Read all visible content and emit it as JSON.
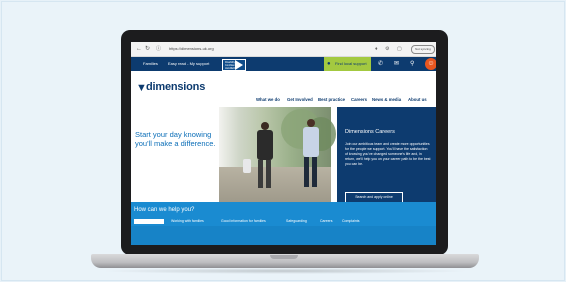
{
  "browser": {
    "url": "https://dimensions-uk.org",
    "profile_button": "Not syncing",
    "icons": [
      "back-icon",
      "reload-icon",
      "info-icon",
      "translate-icon",
      "extension-icon",
      "tab-icon"
    ]
  },
  "top_nav": {
    "links": [
      "Families",
      "Easy read - My support"
    ],
    "logo_text": "Disability Confident LEADER",
    "find_local": "Find local support",
    "icons": [
      "phone-icon",
      "mail-icon",
      "search-icon",
      "accessibility-icon"
    ]
  },
  "header": {
    "logo": "dimensions",
    "nav": [
      "What we do",
      "Get Involved",
      "Best practice",
      "Careers",
      "News & media",
      "About us"
    ]
  },
  "hero": {
    "heading": "Start your day knowing you'll make a difference."
  },
  "careers": {
    "title": "Dimensions Careers",
    "body": "Join our ambitious team and create more opportunities for the people we support. You'll have the satisfaction of knowing you've changed someone's life and, in return, we'll help you on your career path to be the best you can be.",
    "button": "Search and apply online"
  },
  "help": {
    "title": "How can we help you?",
    "tabs": [
      "",
      "Working with families",
      "Good information for families",
      "Safeguarding",
      "Careers",
      "Complaints"
    ]
  },
  "colors": {
    "navy": "#0d3b6f",
    "blue": "#1a8bd1",
    "green": "#a3c940",
    "accessibility": "#e9561f",
    "hero_heading": "#0d6fb8"
  }
}
